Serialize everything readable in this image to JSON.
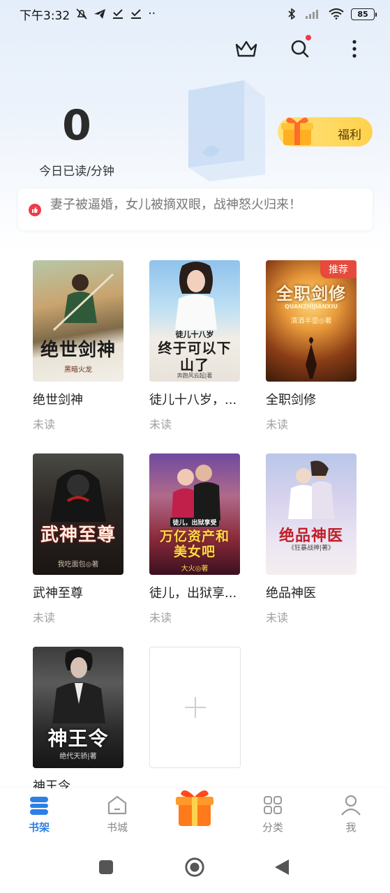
{
  "status_bar": {
    "time": "下午3:32",
    "dots": "··",
    "battery": "85",
    "icons": [
      "mute-bell-icon",
      "telegram-icon",
      "download-check-icon",
      "download-check-icon",
      "bluetooth-icon",
      "signal-icon",
      "wifi-icon",
      "battery-icon"
    ]
  },
  "toolbar": {
    "icons": [
      "crown-icon",
      "search-icon",
      "more-vertical-icon"
    ]
  },
  "reading": {
    "count": "0",
    "label": "今日已读/分钟"
  },
  "welfare": {
    "label": "福利"
  },
  "notice": {
    "text": "妻子被逼婚，女儿被摘双眼，战神怒火归来！"
  },
  "books": [
    {
      "title": "绝世剑神",
      "status": "未读",
      "cover_title": "绝世剑神",
      "cover_author": "黑暗火龙",
      "badge": ""
    },
    {
      "title": "徒儿十八岁，...",
      "status": "未读",
      "cover_title": "终于可以下山了",
      "cover_sub": "徒儿十八岁",
      "cover_author": "奔跑风云起|著",
      "badge": ""
    },
    {
      "title": "全职剑修",
      "status": "未读",
      "cover_title": "全职剑修",
      "cover_sub": "QUANZHIJIANXIU",
      "cover_author": "清酒半壶◎著",
      "badge": "推荐"
    },
    {
      "title": "武神至尊",
      "status": "未读",
      "cover_title": "武神至尊",
      "cover_author": "我吃面包◎著",
      "badge": ""
    },
    {
      "title": "徒儿，出狱享...",
      "status": "未读",
      "cover_title": "万亿资产和美女吧",
      "cover_sub": "徒儿，出狱享受",
      "cover_author": "大火◎著",
      "badge": ""
    },
    {
      "title": "绝品神医",
      "status": "未读",
      "cover_title": "绝品神医",
      "cover_author": "《狂暴战神|著》",
      "badge": ""
    },
    {
      "title": "神王令",
      "status": "",
      "cover_title": "神王令",
      "cover_author": "绝代天骄|著",
      "badge": ""
    }
  ],
  "tabs": [
    {
      "label": "书架",
      "icon": "bookshelf-icon",
      "active": true
    },
    {
      "label": "书城",
      "icon": "bookstore-icon",
      "active": false
    },
    {
      "label": "",
      "icon": "gift-box-icon",
      "active": false
    },
    {
      "label": "分类",
      "icon": "category-grid-icon",
      "active": false
    },
    {
      "label": "我",
      "icon": "profile-icon",
      "active": false
    }
  ],
  "colors": {
    "accent": "#2b7fe6",
    "badge": "#e64a3c",
    "welfare": "#ffd24d",
    "notice_icon": "#ef3b4c"
  }
}
